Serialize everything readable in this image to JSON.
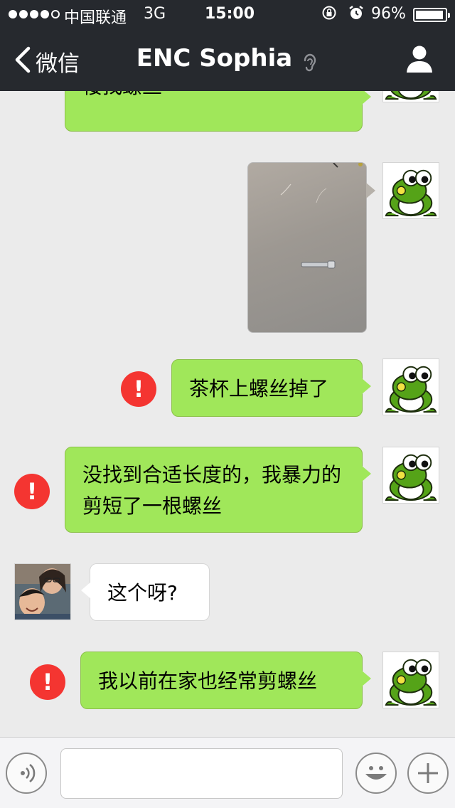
{
  "status_bar": {
    "carrier": "中国联通",
    "network": "3G",
    "time": "15:00",
    "battery_percent": "96%",
    "battery_level": 0.96
  },
  "nav": {
    "back_label": "微信",
    "title": "ENC Sophia",
    "icons": [
      "chevron-left-icon",
      "ear-icon",
      "profile-icon"
    ]
  },
  "messages": [
    {
      "sender": "me",
      "type": "text",
      "text": "楼找螺丝",
      "failed": false
    },
    {
      "sender": "me",
      "type": "image",
      "failed": false
    },
    {
      "sender": "me",
      "type": "text",
      "text": "茶杯上螺丝掉了",
      "failed": true
    },
    {
      "sender": "me",
      "type": "text",
      "text": "没找到合适长度的，我暴力的剪短了一根螺丝",
      "failed": true
    },
    {
      "sender": "contact",
      "type": "text",
      "text": "这个呀?",
      "failed": false
    },
    {
      "sender": "me",
      "type": "text",
      "text": "我以前在家也经常剪螺丝",
      "failed": true
    }
  ],
  "input_bar": {
    "value": "",
    "icons": [
      "voice-icon",
      "emoji-icon",
      "plus-icon"
    ]
  },
  "colors": {
    "nav_bg": "#26292e",
    "chat_bg": "#ebebeb",
    "outgoing_bubble": "#a0e75a",
    "incoming_bubble": "#ffffff",
    "error_badge": "#f43531"
  }
}
